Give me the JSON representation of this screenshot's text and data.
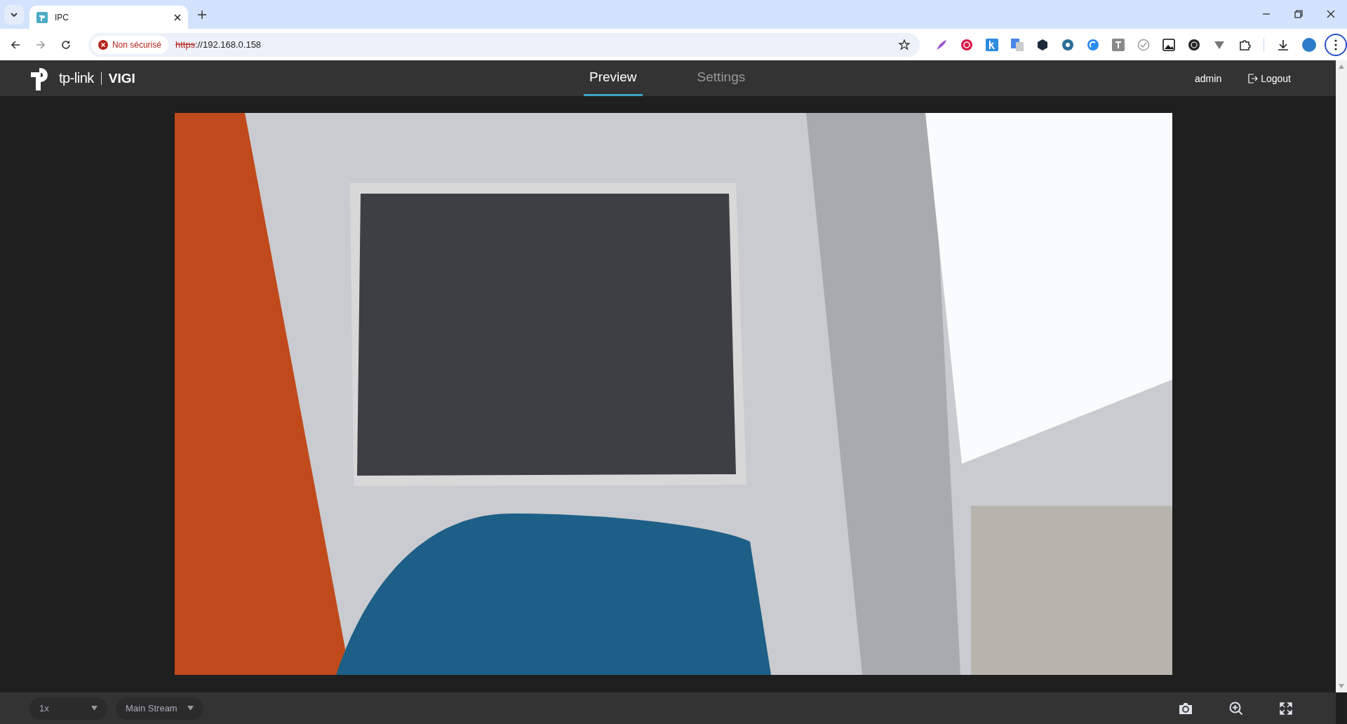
{
  "browser": {
    "tab": {
      "title": "IPC"
    },
    "security_label": "Non sécurisé",
    "url": {
      "scheme": "https",
      "rest": "://192.168.0.158"
    }
  },
  "header": {
    "logo": {
      "brand": "tp-link",
      "product": "VIGI"
    },
    "nav": [
      {
        "label": "Preview",
        "selected": true
      },
      {
        "label": "Settings",
        "selected": false
      }
    ],
    "user": "admin",
    "logout": "Logout"
  },
  "controls": {
    "zoom": {
      "value": "1x"
    },
    "stream": {
      "value": "Main Stream"
    }
  }
}
